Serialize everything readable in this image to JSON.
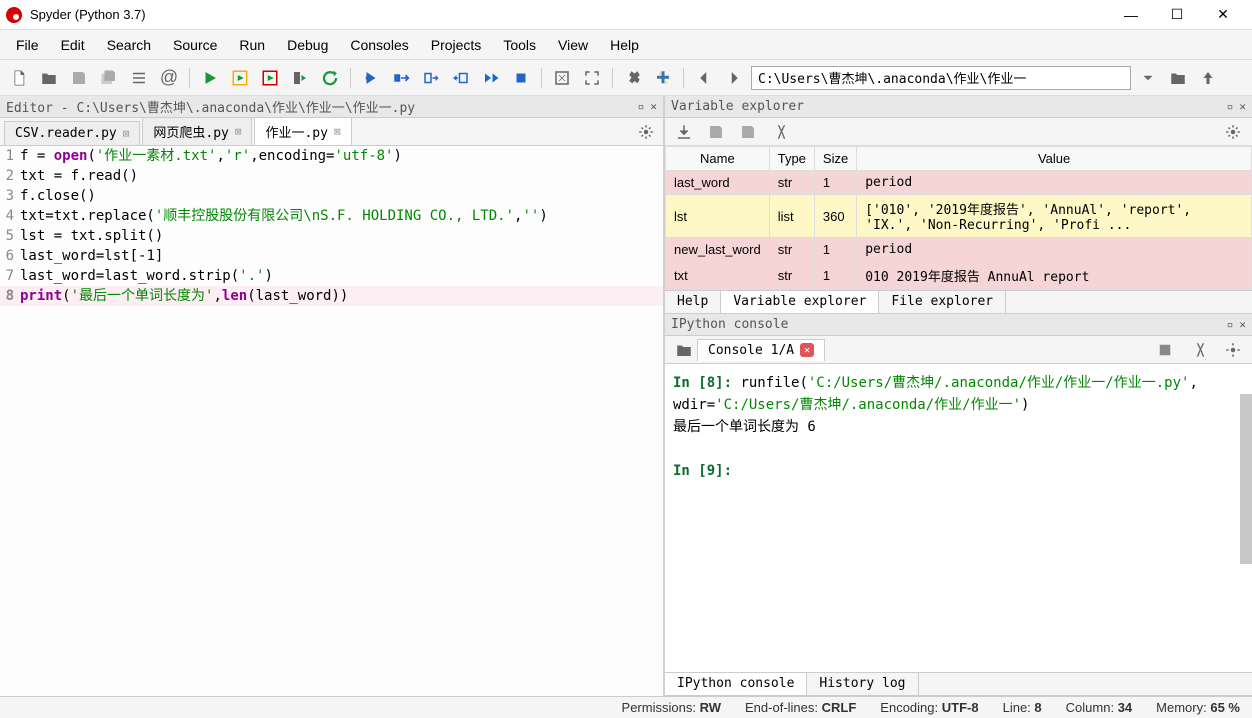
{
  "window": {
    "title": "Spyder (Python 3.7)"
  },
  "menu": [
    "File",
    "Edit",
    "Search",
    "Source",
    "Run",
    "Debug",
    "Consoles",
    "Projects",
    "Tools",
    "View",
    "Help"
  ],
  "toolbar": {
    "path": "C:\\Users\\曹杰坤\\.anaconda\\作业\\作业一"
  },
  "editor": {
    "pane_title": "Editor - C:\\Users\\曹杰坤\\.anaconda\\作业\\作业一\\作业一.py",
    "tabs": [
      {
        "label": "CSV.reader.py",
        "active": false
      },
      {
        "label": "网页爬虫.py",
        "active": false
      },
      {
        "label": "作业一.py",
        "active": true
      }
    ],
    "lines": [
      {
        "n": "1",
        "tokens": [
          {
            "t": "f = ",
            "c": ""
          },
          {
            "t": "open",
            "c": "bi"
          },
          {
            "t": "(",
            "c": ""
          },
          {
            "t": "'作业一素材.txt'",
            "c": "str"
          },
          {
            "t": ",",
            "c": ""
          },
          {
            "t": "'r'",
            "c": "str"
          },
          {
            "t": ",encoding=",
            "c": ""
          },
          {
            "t": "'utf-8'",
            "c": "str"
          },
          {
            "t": ")",
            "c": ""
          }
        ]
      },
      {
        "n": "2",
        "tokens": [
          {
            "t": "txt = f.read()",
            "c": ""
          }
        ]
      },
      {
        "n": "3",
        "tokens": [
          {
            "t": "f.close()",
            "c": ""
          }
        ]
      },
      {
        "n": "4",
        "tokens": [
          {
            "t": "txt=txt.replace(",
            "c": ""
          },
          {
            "t": "'顺丰控股股份有限公司\\nS.F. HOLDING CO., LTD.'",
            "c": "str"
          },
          {
            "t": ",",
            "c": ""
          },
          {
            "t": "''",
            "c": "str"
          },
          {
            "t": ")",
            "c": ""
          }
        ]
      },
      {
        "n": "5",
        "tokens": [
          {
            "t": "lst = txt.split()",
            "c": ""
          }
        ]
      },
      {
        "n": "6",
        "tokens": [
          {
            "t": "last_word=lst[-",
            "c": ""
          },
          {
            "t": "1",
            "c": "num"
          },
          {
            "t": "]",
            "c": ""
          }
        ]
      },
      {
        "n": "7",
        "tokens": [
          {
            "t": "last_word=last_word.strip(",
            "c": ""
          },
          {
            "t": "'.'",
            "c": "str"
          },
          {
            "t": ")",
            "c": ""
          }
        ]
      },
      {
        "n": "8",
        "tokens": [
          {
            "t": "print",
            "c": "bi"
          },
          {
            "t": "(",
            "c": ""
          },
          {
            "t": "'最后一个单词长度为'",
            "c": "str"
          },
          {
            "t": ",",
            "c": ""
          },
          {
            "t": "len",
            "c": "bi"
          },
          {
            "t": "(last_word)",
            "c": ""
          },
          {
            "t": ")",
            "c": ""
          }
        ],
        "hl": true,
        "bold_gutter": true
      }
    ]
  },
  "var_explorer": {
    "title": "Variable explorer",
    "cols": [
      "Name",
      "Type",
      "Size",
      "Value"
    ],
    "rows": [
      {
        "name": "last_word",
        "type": "str",
        "size": "1",
        "value": "period",
        "cls": "r1"
      },
      {
        "name": "lst",
        "type": "list",
        "size": "360",
        "value": "['010', '2019年度报告', 'AnnuAl', 'report', 'IX.', 'Non-Recurring', 'Profi ...",
        "cls": "r2"
      },
      {
        "name": "new_last_word",
        "type": "str",
        "size": "1",
        "value": "period",
        "cls": "r3"
      },
      {
        "name": "txt",
        "type": "str",
        "size": "1",
        "value": "010\n2019年度报告 AnnuAl report",
        "cls": "r4"
      }
    ],
    "sub_tabs": [
      "Help",
      "Variable explorer",
      "File explorer"
    ]
  },
  "console": {
    "title": "IPython console",
    "tab": "Console 1/A",
    "lines": [
      {
        "prompt": "In [8]: ",
        "cmd_pre": "runfile(",
        "cmd_str": "'C:/Users/曹杰坤/.anaconda/作业/作业一/作业一.py'",
        "cmd_mid": ", wdir=",
        "cmd_str2": "'C:/Users/曹杰坤/.anaconda/作业/作业一'",
        "cmd_post": ")"
      },
      {
        "output": "最后一个单词长度为 6"
      },
      {
        "blank": true
      },
      {
        "prompt": "In [9]: "
      }
    ],
    "sub_tabs": [
      "IPython console",
      "History log"
    ]
  },
  "status": {
    "perm_label": "Permissions:",
    "perm": "RW",
    "eol_label": "End-of-lines:",
    "eol": "CRLF",
    "enc_label": "Encoding:",
    "enc": "UTF-8",
    "line_label": "Line:",
    "line": "8",
    "col_label": "Column:",
    "col": "34",
    "mem_label": "Memory:",
    "mem": "65 %"
  }
}
